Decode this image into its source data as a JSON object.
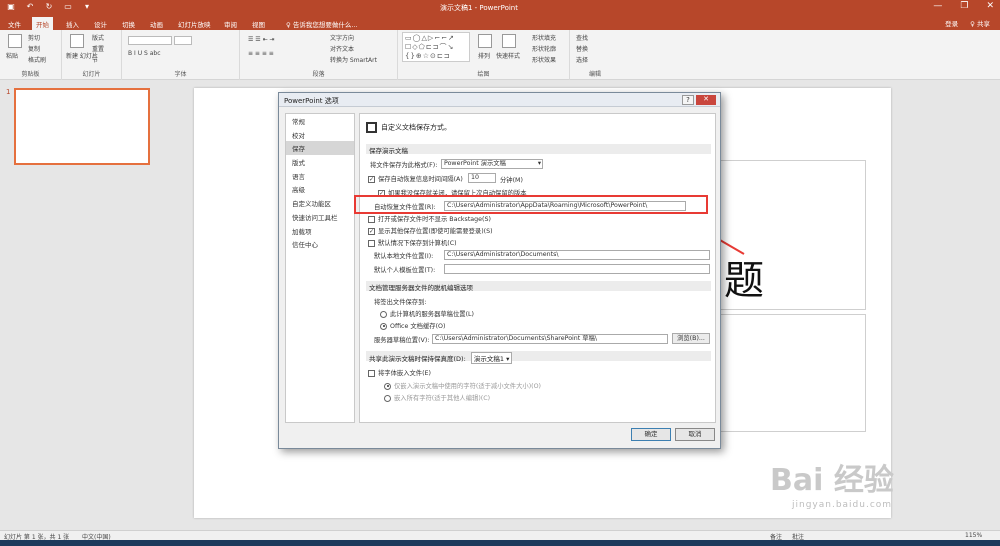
{
  "window": {
    "title": "演示文稿1 - PowerPoint",
    "qat_icons": [
      "save-icon",
      "undo-icon",
      "redo-icon",
      "start-from-beginning-icon",
      "customize-qat-icon"
    ],
    "min": "—",
    "restore": "❐",
    "close": "✕"
  },
  "tabs": [
    "文件",
    "开始",
    "插入",
    "设计",
    "切换",
    "动画",
    "幻灯片放映",
    "审阅",
    "视图"
  ],
  "active_tab": "开始",
  "tellme": "♀ 告诉我您想要做什么...",
  "login": "登录",
  "share": "♀ 共享",
  "ribbon": {
    "clipboard": {
      "label": "剪贴板",
      "paste": "粘贴",
      "cut": "剪切",
      "copy": "复制",
      "format_painter": "格式刷"
    },
    "slides": {
      "label": "幻灯片",
      "new_slide": "新建\n幻灯片",
      "layout": "版式",
      "reset": "重置",
      "section": "节"
    },
    "font": {
      "label": "字体"
    },
    "paragraph": {
      "label": "段落",
      "text_direction": "文字方向",
      "align_text": "对齐文本",
      "convert_smartart": "转换为 SmartArt"
    },
    "drawing": {
      "label": "绘图",
      "arrange": "排列",
      "quick_styles": "快速样式",
      "shape_fill": "形状填充",
      "shape_outline": "形状轮廓",
      "shape_effects": "形状效果"
    },
    "editing": {
      "label": "编辑",
      "find": "查找",
      "replace": "替换",
      "select": "选择"
    }
  },
  "thumbnail_number": "1",
  "slide": {
    "title_char": "题"
  },
  "dialog": {
    "title": "PowerPoint 选项",
    "help": "?",
    "close": "✕",
    "nav": [
      "常规",
      "校对",
      "保存",
      "版式",
      "语言",
      "高级",
      "自定义功能区",
      "快速访问工具栏",
      "加载项",
      "信任中心"
    ],
    "selected_nav": "保存",
    "header": "自定义文档保存方式。",
    "section1": "保存演示文稿",
    "save_format_label": "将文件保存为此格式(F):",
    "save_format_value": "PowerPoint 演示文稿",
    "autorecover_label": "保存自动恢复信息时间间隔(A)",
    "autorecover_minutes": "10",
    "minutes_label": "分钟(M)",
    "keep_last_label": "如果我没保存就关闭，请保留上次自动保留的版本",
    "autorecover_location_label": "自动恢复文件位置(R):",
    "autorecover_location_value": "C:\\Users\\Administrator\\AppData\\Roaming\\Microsoft\\PowerPoint\\",
    "backstage_label": "打开或保存文件时不显示 Backstage(S)",
    "other_locations_label": "显示其他保存位置(即使可能需要登录)(S)",
    "default_computer_label": "默认情况下保存到计算机(C)",
    "default_local_label": "默认本地文件位置(I):",
    "default_local_value": "C:\\Users\\Administrator\\Documents\\",
    "default_template_label": "默认个人模板位置(T):",
    "default_template_value": "",
    "section2": "文档管理服务器文件的脱机编辑选项",
    "checkout_label": "将签出文件保存到:",
    "server_drafts_label": "此计算机的服务器草稿位置(L)",
    "office_cache_label": "Office 文档缓存(O)",
    "server_drafts_location_label": "服务器草稿位置(V):",
    "server_drafts_location_value": "C:\\Users\\Administrator\\Documents\\SharePoint 草稿\\",
    "browse": "浏览(B)...",
    "section3": "共享此演示文稿时保持保真度(D):",
    "section3_doc": "演示文稿1",
    "embed_fonts_label": "将字体嵌入文件(E)",
    "embed_used_label": "仅嵌入演示文稿中使用的字符(适于减小文件大小)(O)",
    "embed_all_label": "嵌入所有字符(适于其他人编辑)(C)",
    "ok": "确定",
    "cancel": "取消"
  },
  "statusbar": {
    "slide_info": "幻灯片 第 1 张，共 1 张",
    "language": "中文(中国)",
    "notes": "备注",
    "comments": "批注",
    "zoom": "115%"
  },
  "watermark": {
    "main": "Bai 经验",
    "sub": "jingyan.baidu.com"
  },
  "colors": {
    "accent": "#b7472a",
    "highlight": "#e83a34"
  }
}
